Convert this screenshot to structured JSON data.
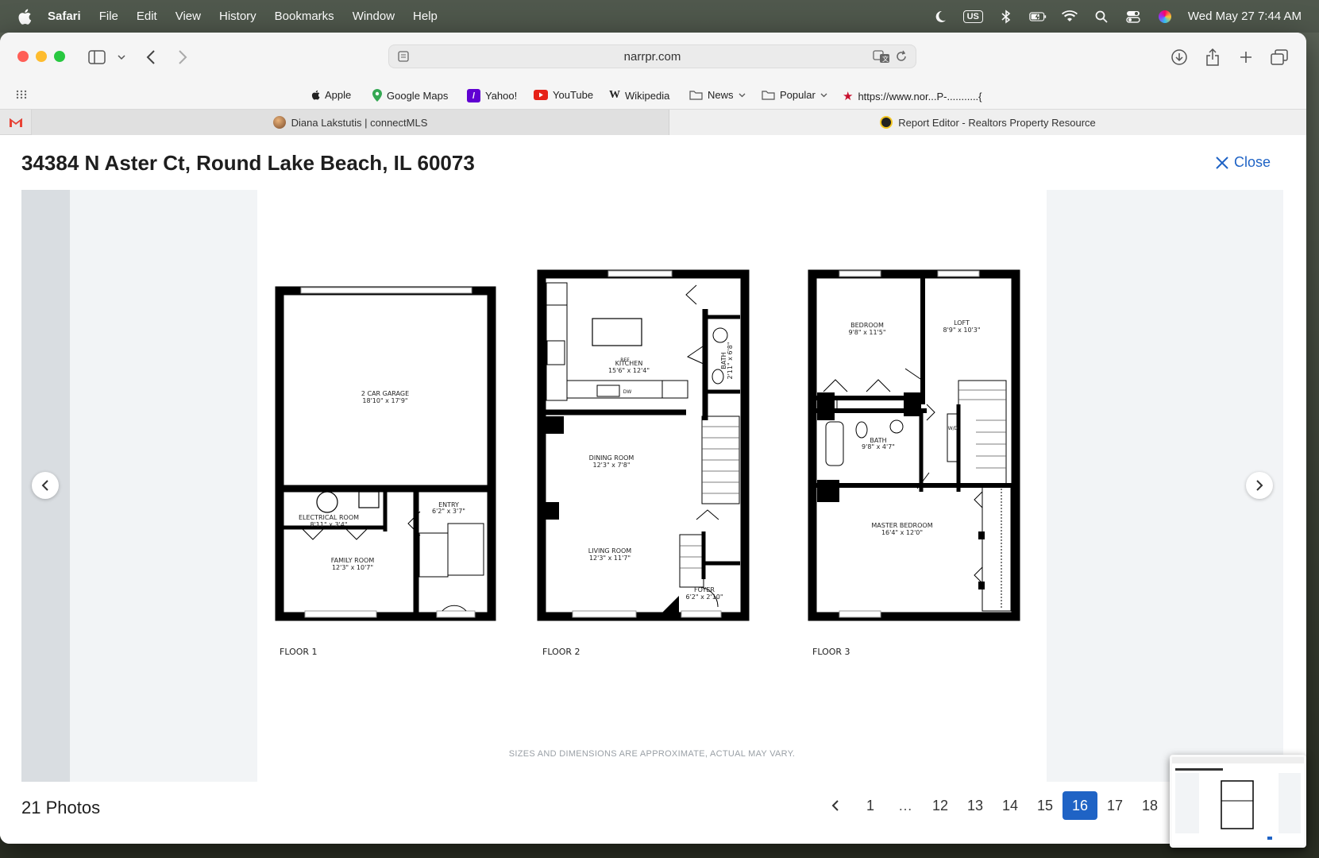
{
  "menubar": {
    "app": "Safari",
    "items": [
      "File",
      "Edit",
      "View",
      "History",
      "Bookmarks",
      "Window",
      "Help"
    ],
    "keyboard": "US",
    "clock": "Wed May 27  7:44 AM"
  },
  "browser": {
    "url": "narrpr.com",
    "bookmarks": [
      "Apple",
      "Google Maps",
      "Yahoo!",
      "YouTube",
      "Wikipedia",
      "News",
      "Popular",
      "https://www.nor...P-...........{"
    ],
    "tabs": [
      "Diana Lakstutis | connectMLS",
      "Report Editor - Realtors Property Resource"
    ]
  },
  "listing": {
    "title": "34384 N Aster Ct, Round Lake Beach, IL 60073",
    "close_label": "Close",
    "photos_count": "21 Photos"
  },
  "floorplan": {
    "floors": [
      "FLOOR 1",
      "FLOOR 2",
      "FLOOR 3"
    ],
    "disclaimer": "SIZES AND DIMENSIONS ARE APPROXIMATE, ACTUAL MAY VARY.",
    "rooms": {
      "garage": [
        "2 CAR GARAGE",
        "18'10\" x 17'9\""
      ],
      "electrical": [
        "ELECTRICAL ROOM",
        "8'11\" x 3'4\""
      ],
      "entry": [
        "ENTRY",
        "6'2\" x 3'7\""
      ],
      "family": [
        "FAMILY ROOM",
        "12'3\" x 10'7\""
      ],
      "kitchen": [
        "KITCHEN",
        "15'6\" x 12'4\""
      ],
      "bath2": [
        "BATH",
        "2'11\" x 6'8\""
      ],
      "dining": [
        "DINING ROOM",
        "12'3\" x 7'8\""
      ],
      "living": [
        "LIVING ROOM",
        "12'3\" x 11'7\""
      ],
      "foyer": [
        "FOYER",
        "6'2\" x 2'10\""
      ],
      "bedroom": [
        "BEDROOM",
        "9'8\" x 11'5\""
      ],
      "loft": [
        "LOFT",
        "8'9\" x 10'3\""
      ],
      "bath3": [
        "BATH",
        "9'8\" x 4'7\""
      ],
      "master": [
        "MASTER BEDROOM",
        "16'4\" x 12'0\""
      ],
      "ref": "REF",
      "dw": "DW",
      "wd": "W/D"
    }
  },
  "pagination": {
    "pages": [
      "1",
      "…",
      "12",
      "13",
      "14",
      "15",
      "16",
      "17",
      "18",
      "1"
    ],
    "active": "16"
  },
  "colors": {
    "accent": "#1f63c5",
    "wall": "#000000"
  }
}
